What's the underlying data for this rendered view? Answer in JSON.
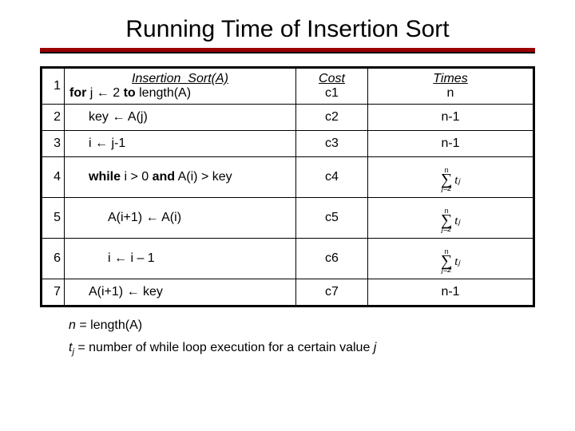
{
  "title": "Running Time of Insertion Sort",
  "headers": {
    "algorithm": "Insertion_Sort(A)",
    "cost": "Cost",
    "times": "Times"
  },
  "rows": [
    {
      "n": "1",
      "code_pre": "for",
      "code_mid": " j ← 2 ",
      "code_post": "to",
      "code_tail": " length(A)",
      "indent": 0,
      "cost": "c1",
      "times": "n",
      "times_type": "text"
    },
    {
      "n": "2",
      "code_pre": "",
      "code_mid": "key ← A(j)",
      "code_post": "",
      "code_tail": "",
      "indent": 1,
      "cost": "c2",
      "times": "n-1",
      "times_type": "text"
    },
    {
      "n": "3",
      "code_pre": "",
      "code_mid": "i ← j-1",
      "code_post": "",
      "code_tail": "",
      "indent": 1,
      "cost": "c3",
      "times": "n-1",
      "times_type": "text"
    },
    {
      "n": "4",
      "code_pre": "while",
      "code_mid": " i > 0 ",
      "code_post": "and",
      "code_tail": " A(i) > key",
      "indent": 1,
      "cost": "c4",
      "times": "",
      "times_type": "sum",
      "sum_term": "tⱼ"
    },
    {
      "n": "5",
      "code_pre": "",
      "code_mid": "A(i+1) ← A(i)",
      "code_post": "",
      "code_tail": "",
      "indent": 2,
      "cost": "c5",
      "times": "",
      "times_type": "sum",
      "sum_term": "tⱼ"
    },
    {
      "n": "6",
      "code_pre": "",
      "code_mid": "i ← i – 1",
      "code_post": "",
      "code_tail": "",
      "indent": 2,
      "cost": "c6",
      "times": "",
      "times_type": "sum",
      "sum_term": "tⱼ"
    },
    {
      "n": "7",
      "code_pre": "",
      "code_mid": "A(i+1) ← key",
      "code_post": "",
      "code_tail": "",
      "indent": 1,
      "cost": "c7",
      "times": "n-1",
      "times_type": "text"
    }
  ],
  "sum_limits": {
    "lower": "j=2",
    "upper": "n"
  },
  "footnotes": {
    "f1_var": "n",
    "f1_text": " = length(A)",
    "f2_var": "t",
    "f2_sub": "j",
    "f2_text": " = number of while loop execution for a certain value ",
    "f2_tail": "j"
  }
}
